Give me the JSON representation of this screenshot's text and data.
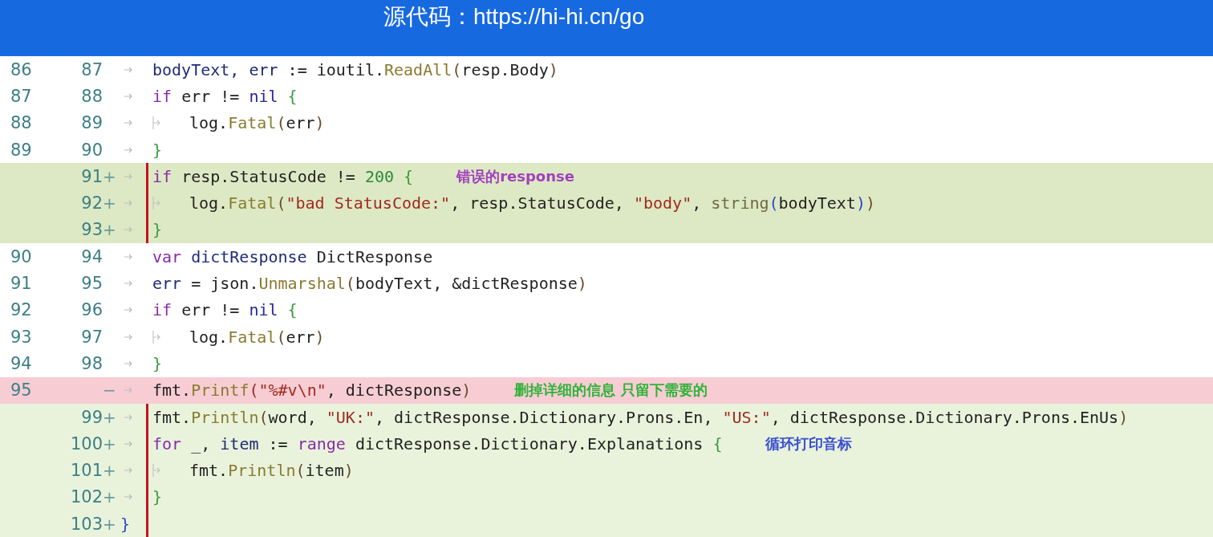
{
  "banner": {
    "title": "源代码：https://hi-hi.cn/go"
  },
  "rows": [
    {
      "kind": "context",
      "old": "86",
      "new": "87",
      "marker": "",
      "indented": false,
      "marked": false,
      "code": [
        {
          "text": "bodyText, err",
          "kind": "var"
        },
        {
          "text": " := ioutil.",
          "kind": "plain"
        },
        {
          "text": "ReadAll",
          "kind": "func"
        },
        {
          "text": "(",
          "kind": "paren"
        },
        {
          "text": "resp.Body",
          "kind": "plain"
        },
        {
          "text": ")",
          "kind": "paren"
        }
      ]
    },
    {
      "kind": "context",
      "old": "87",
      "new": "88",
      "marker": "",
      "indented": false,
      "marked": false,
      "code": [
        {
          "text": "if",
          "kind": "keyword"
        },
        {
          "text": " err != ",
          "kind": "plain"
        },
        {
          "text": "nil",
          "kind": "const"
        },
        {
          "text": " {",
          "kind": "brace"
        }
      ]
    },
    {
      "kind": "context",
      "old": "88",
      "new": "89",
      "marker": "",
      "indented": true,
      "marked": false,
      "code": [
        {
          "text": "log.",
          "kind": "plain"
        },
        {
          "text": "Fatal",
          "kind": "func"
        },
        {
          "text": "(",
          "kind": "paren"
        },
        {
          "text": "err",
          "kind": "plain"
        },
        {
          "text": ")",
          "kind": "paren"
        }
      ]
    },
    {
      "kind": "context",
      "old": "89",
      "new": "90",
      "marker": "",
      "indented": false,
      "marked": false,
      "code": [
        {
          "text": "}",
          "kind": "brace"
        }
      ]
    },
    {
      "kind": "added",
      "old": "",
      "new": "91",
      "marker": "+",
      "indented": false,
      "marked": true,
      "code": [
        {
          "text": "if",
          "kind": "keyword"
        },
        {
          "text": " resp.StatusCode != ",
          "kind": "plain"
        },
        {
          "text": "200",
          "kind": "number"
        },
        {
          "text": " {",
          "kind": "brace"
        }
      ],
      "note": {
        "text": "错误的response",
        "color": "#a23fc0"
      }
    },
    {
      "kind": "added",
      "old": "",
      "new": "92",
      "marker": "+",
      "indented": true,
      "marked": true,
      "code": [
        {
          "text": "log.",
          "kind": "plain"
        },
        {
          "text": "Fatal",
          "kind": "func"
        },
        {
          "text": "(",
          "kind": "paren"
        },
        {
          "text": "\"bad StatusCode:\"",
          "kind": "string"
        },
        {
          "text": ", resp.StatusCode, ",
          "kind": "plain"
        },
        {
          "text": "\"body\"",
          "kind": "string"
        },
        {
          "text": ", ",
          "kind": "plain"
        },
        {
          "text": "string",
          "kind": "builtin"
        },
        {
          "text": "(",
          "kind": "blue"
        },
        {
          "text": "bodyText",
          "kind": "plain"
        },
        {
          "text": ")",
          "kind": "blue"
        },
        {
          "text": ")",
          "kind": "paren"
        }
      ]
    },
    {
      "kind": "added",
      "old": "",
      "new": "93",
      "marker": "+",
      "indented": false,
      "marked": true,
      "code": [
        {
          "text": "}",
          "kind": "brace"
        }
      ]
    },
    {
      "kind": "context",
      "old": "90",
      "new": "94",
      "marker": "",
      "indented": false,
      "marked": false,
      "code": [
        {
          "text": "var",
          "kind": "keyword"
        },
        {
          "text": " dictResponse",
          "kind": "var"
        },
        {
          "text": " DictResponse",
          "kind": "plain"
        }
      ]
    },
    {
      "kind": "context",
      "old": "91",
      "new": "95",
      "marker": "",
      "indented": false,
      "marked": false,
      "code": [
        {
          "text": "err",
          "kind": "var"
        },
        {
          "text": " = json.",
          "kind": "plain"
        },
        {
          "text": "Unmarshal",
          "kind": "func"
        },
        {
          "text": "(",
          "kind": "paren"
        },
        {
          "text": "bodyText, &dictResponse",
          "kind": "plain"
        },
        {
          "text": ")",
          "kind": "paren"
        }
      ]
    },
    {
      "kind": "context",
      "old": "92",
      "new": "96",
      "marker": "",
      "indented": false,
      "marked": false,
      "code": [
        {
          "text": "if",
          "kind": "keyword"
        },
        {
          "text": " err != ",
          "kind": "plain"
        },
        {
          "text": "nil",
          "kind": "const"
        },
        {
          "text": " {",
          "kind": "brace"
        }
      ]
    },
    {
      "kind": "context",
      "old": "93",
      "new": "97",
      "marker": "",
      "indented": true,
      "marked": false,
      "code": [
        {
          "text": "log.",
          "kind": "plain"
        },
        {
          "text": "Fatal",
          "kind": "func"
        },
        {
          "text": "(",
          "kind": "paren"
        },
        {
          "text": "err",
          "kind": "plain"
        },
        {
          "text": ")",
          "kind": "paren"
        }
      ]
    },
    {
      "kind": "context",
      "old": "94",
      "new": "98",
      "marker": "",
      "indented": false,
      "marked": false,
      "code": [
        {
          "text": "}",
          "kind": "brace"
        }
      ]
    },
    {
      "kind": "removed",
      "old": "95",
      "new": "",
      "marker": "−",
      "indented": false,
      "marked": false,
      "code": [
        {
          "text": "fmt.",
          "kind": "plain"
        },
        {
          "text": "Printf",
          "kind": "func"
        },
        {
          "text": "(\"%#v\\n\"",
          "kind": "string"
        },
        {
          "text": ", dictResponse",
          "kind": "plain"
        },
        {
          "text": ")",
          "kind": "paren"
        }
      ],
      "note": {
        "text": "删掉详细的信息 只留下需要的",
        "color": "#2fb33a"
      }
    },
    {
      "kind": "added",
      "old": "",
      "new": "99",
      "marker": "+",
      "indented": false,
      "marked": true,
      "code": [
        {
          "text": "fmt.",
          "kind": "plain"
        },
        {
          "text": "Println",
          "kind": "func"
        },
        {
          "text": "(",
          "kind": "paren"
        },
        {
          "text": "word, ",
          "kind": "plain"
        },
        {
          "text": "\"UK:\"",
          "kind": "string"
        },
        {
          "text": ", dictResponse.Dictionary.Prons.En, ",
          "kind": "plain"
        },
        {
          "text": "\"US:\"",
          "kind": "string"
        },
        {
          "text": ", dictResponse.Dictionary.Prons.EnUs",
          "kind": "plain"
        },
        {
          "text": ")",
          "kind": "paren"
        }
      ]
    },
    {
      "kind": "added",
      "old": "",
      "new": "100",
      "marker": "+",
      "indented": false,
      "marked": true,
      "code": [
        {
          "text": "for",
          "kind": "keyword"
        },
        {
          "text": " _, ",
          "kind": "plain"
        },
        {
          "text": "item",
          "kind": "var"
        },
        {
          "text": " := ",
          "kind": "plain"
        },
        {
          "text": "range",
          "kind": "keyword"
        },
        {
          "text": " dictResponse.Dictionary.Explanations ",
          "kind": "plain"
        },
        {
          "text": "{",
          "kind": "brace"
        }
      ],
      "note": {
        "text": "循环打印音标",
        "color": "#3a4fd0"
      }
    },
    {
      "kind": "added",
      "old": "",
      "new": "101",
      "marker": "+",
      "indented": true,
      "marked": true,
      "code": [
        {
          "text": "fmt.",
          "kind": "plain"
        },
        {
          "text": "Println",
          "kind": "func"
        },
        {
          "text": "(",
          "kind": "paren"
        },
        {
          "text": "item",
          "kind": "plain"
        },
        {
          "text": ")",
          "kind": "paren"
        }
      ]
    },
    {
      "kind": "added",
      "old": "",
      "new": "102",
      "marker": "+",
      "indented": false,
      "marked": true,
      "code": [
        {
          "text": "}",
          "kind": "brace"
        }
      ]
    },
    {
      "kind": "added",
      "old": "",
      "new": "103",
      "marker": "+",
      "indented": false,
      "marked": true,
      "outdent": true,
      "code": [
        {
          "text": "}",
          "kind": "blue"
        }
      ]
    }
  ]
}
